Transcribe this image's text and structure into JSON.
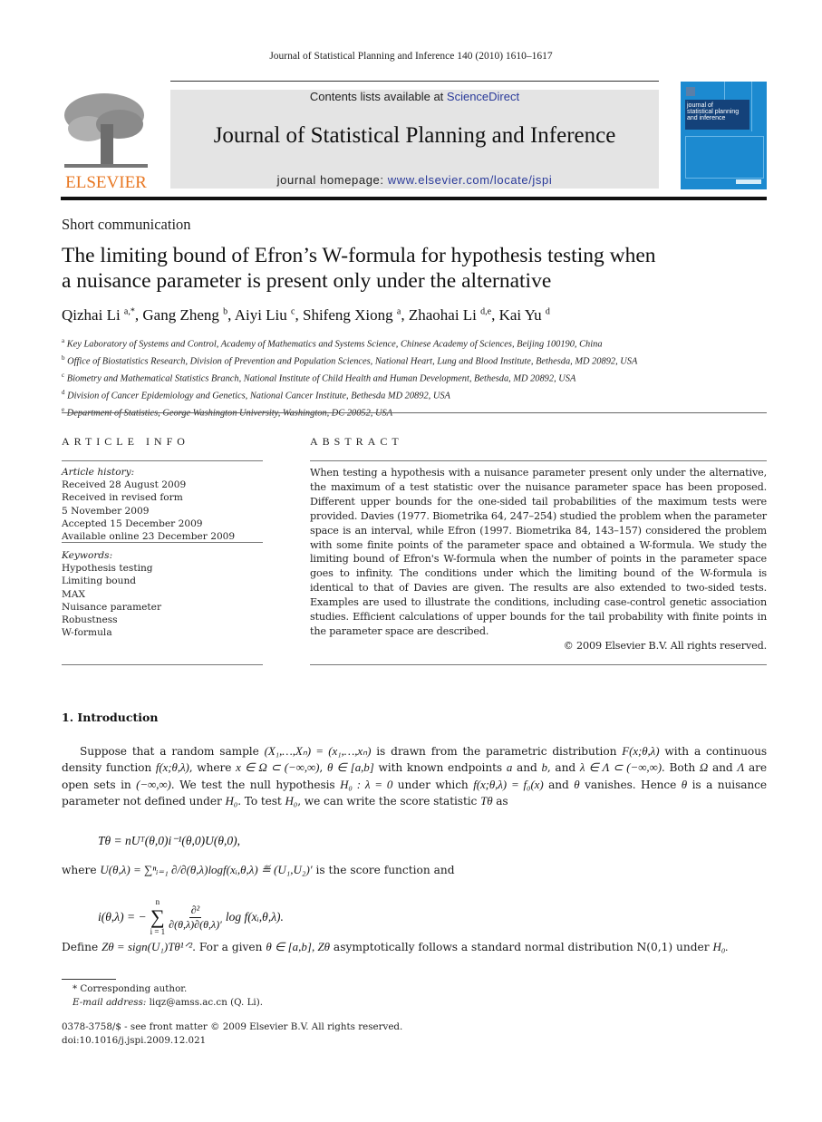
{
  "running_head": "Journal of Statistical Planning and Inference 140 (2010) 1610–1617",
  "masthead": {
    "publisher_logo_text": "ELSEVIER",
    "contents_prefix": "Contents lists available at ",
    "contents_link": "ScienceDirect",
    "journal_name": "Journal of Statistical Planning and Inference",
    "homepage_prefix": "journal homepage: ",
    "homepage_link": "www.elsevier.com/locate/jspi",
    "cover_title_lines": [
      "journal of",
      "statistical planning",
      "and inference"
    ],
    "colors": {
      "publisher_orange": "#e87722",
      "link_blue": "#2a3a9a",
      "cover_blue": "#1c8ad0",
      "banner_gray": "#e4e4e4"
    }
  },
  "article": {
    "type": "Short communication",
    "title_lines": [
      "The limiting bound of Efron’s W-formula for hypothesis testing when",
      "a nuisance parameter is present only under the alternative"
    ],
    "authors": [
      {
        "name": "Qizhai Li",
        "sup": "a,*",
        "sep": ", "
      },
      {
        "name": "Gang Zheng",
        "sup": "b",
        "sep": ", "
      },
      {
        "name": "Aiyi Liu",
        "sup": "c",
        "sep": ", "
      },
      {
        "name": "Shifeng Xiong",
        "sup": "a",
        "sep": ", "
      },
      {
        "name": "Zhaohai Li",
        "sup": "d,e",
        "sep": ", "
      },
      {
        "name": "Kai Yu",
        "sup": "d",
        "sep": ""
      }
    ],
    "affiliations": [
      {
        "sup": "a",
        "text": "Key Laboratory of Systems and Control, Academy of Mathematics and Systems Science, Chinese Academy of Sciences, Beijing 100190, China"
      },
      {
        "sup": "b",
        "text": "Office of Biostatistics Research, Division of Prevention and Population Sciences, National Heart, Lung and Blood Institute, Bethesda, MD 20892, USA"
      },
      {
        "sup": "c",
        "text": "Biometry and Mathematical Statistics Branch, National Institute of Child Health and Human Development, Bethesda, MD 20892, USA"
      },
      {
        "sup": "d",
        "text": "Division of Cancer Epidemiology and Genetics, National Cancer Institute, Bethesda MD 20892, USA"
      },
      {
        "sup": "e",
        "text": "Department of Statistics, George Washington University, Washington, DC 20052, USA"
      }
    ]
  },
  "article_info": {
    "heading": "ARTICLE INFO",
    "history_label": "Article history:",
    "history": [
      "Received 28 August 2009",
      "Received in revised form",
      "5 November 2009",
      "Accepted 15 December 2009",
      "Available online 23 December 2009"
    ],
    "keywords_label": "Keywords:",
    "keywords": [
      "Hypothesis testing",
      "Limiting bound",
      "MAX",
      "Nuisance parameter",
      "Robustness",
      "W-formula"
    ]
  },
  "abstract": {
    "heading": "ABSTRACT",
    "text": "When testing a hypothesis with a nuisance parameter present only under the alternative, the maximum of a test statistic over the nuisance parameter space has been proposed. Different upper bounds for the one-sided tail probabilities of the maximum tests were provided. Davies (1977. Biometrika 64, 247–254) studied the problem when the parameter space is an interval, while Efron (1997. Biometrika 84, 143–157) considered the problem with some finite points of the parameter space and obtained a W-formula. We study the limiting bound of Efron's W-formula when the number of points in the parameter space goes to infinity. The conditions under which the limiting bound of the W-formula is identical to that of Davies are given. The results are also extended to two-sided tests. Examples are used to illustrate the conditions, including case-control genetic association studies. Efficient calculations of upper bounds for the tail probability with finite points in the parameter space are described.",
    "copyright": "© 2009 Elsevier B.V. All rights reserved."
  },
  "body": {
    "section_title": "1.  Introduction",
    "para1_parts": [
      "Suppose that a random sample ",
      "(X₁,…,Xₙ) = (x₁,…,xₙ)",
      " is drawn from the parametric distribution ",
      "F(x;θ,λ)",
      " with a continuous density function ",
      "f(x;θ,λ)",
      ", where ",
      "x ∈ Ω ⊂ (−∞,∞)",
      ", ",
      "θ ∈ [a,b]",
      " with known endpoints ",
      "a",
      " and ",
      "b",
      ", and ",
      "λ ∈ Λ ⊂ (−∞,∞)",
      ". Both ",
      "Ω",
      " and ",
      "Λ",
      " are open sets in ",
      "(−∞,∞)",
      ". We test the null hypothesis ",
      "H₀ : λ = 0",
      " under which ",
      "f(x;θ,λ) = f₀(x)",
      " and ",
      "θ",
      " vanishes. Hence ",
      "θ",
      " is a nuisance parameter not defined under ",
      "H₀",
      ". To test ",
      "H₀",
      ", we can write the score statistic ",
      "Tθ",
      " as"
    ],
    "eq1": "Tθ = nUᵀ(θ,0)i⁻¹(θ,0)U(θ,0),",
    "where_prefix": "where ",
    "where_math": "U(θ,λ) = ∑ⁿᵢ₌₁ ∂/∂(θ,λ)logf(xᵢ,θ,λ) ≝ (U₁,U₂)′",
    "where_suffix": " is the score function and",
    "eq2_lhs": "i(θ,λ) = −",
    "eq2_sum_top": "n",
    "eq2_sum_bottom": "i = 1",
    "eq2_frac_num": "∂²",
    "eq2_frac_den": "∂(θ,λ)∂(θ,λ)′",
    "eq2_rhs": "log f(xᵢ,θ,λ).",
    "define_prefix": "Define ",
    "define_math": "Zθ = sign(U₁)Tθ¹ᐟ²",
    "define_mid": ". For a given ",
    "define_math2": "θ ∈ [a,b], Zθ",
    "define_suffix": " asymptotically follows a standard normal distribution N(0,1) under ",
    "define_h0": "H₀."
  },
  "footnotes": {
    "corresponding": "* Corresponding author.",
    "email_label": "E-mail address:",
    "email": " liqz@amss.ac.cn (Q. Li)."
  },
  "front_matter": {
    "issn_line": "0378-3758/$ - see front matter © 2009 Elsevier B.V. All rights reserved.",
    "doi": "doi:10.1016/j.jspi.2009.12.021"
  }
}
